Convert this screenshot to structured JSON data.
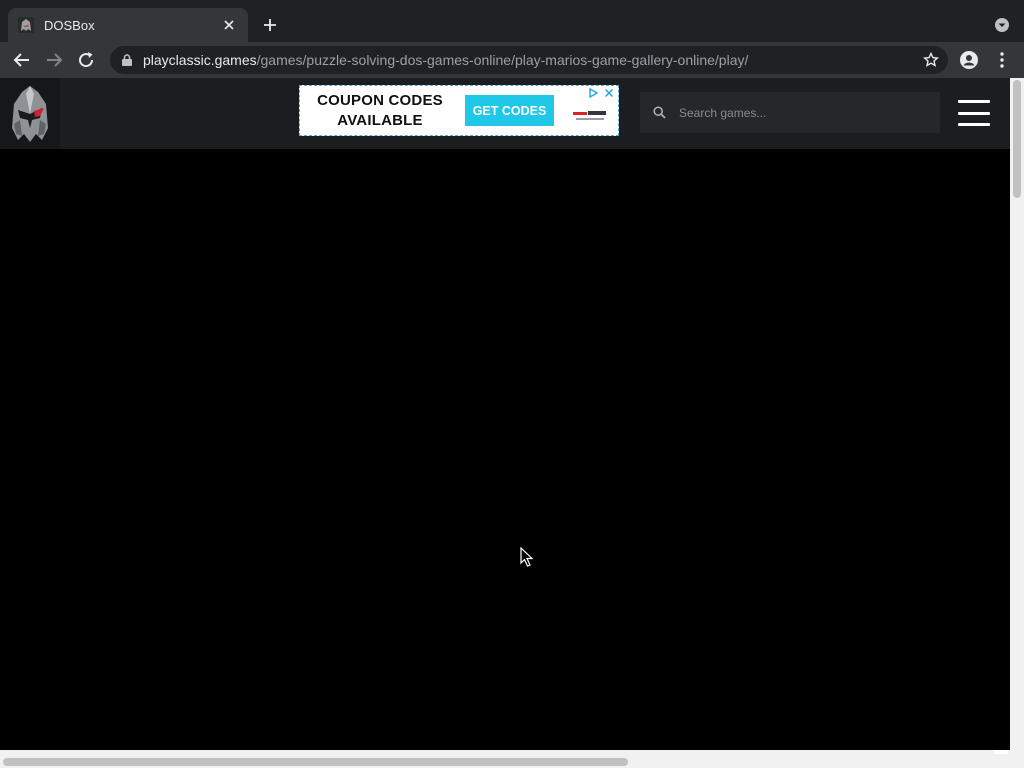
{
  "browser": {
    "tab": {
      "title": "DOSBox",
      "favicon": "helmet-favicon-icon"
    },
    "url": {
      "host": "playclassic.games",
      "path": "/games/puzzle-solving-dos-games-online/play-marios-game-gallery-online/play/"
    }
  },
  "site": {
    "logo": "knight-helmet-logo",
    "ad": {
      "headline_line1": "COUPON CODES",
      "headline_line2": "AVAILABLE",
      "cta": "GET CODES"
    },
    "search": {
      "placeholder": "Search games..."
    },
    "menu_icon": "hamburger-menu-icon"
  },
  "colors": {
    "browser_dark": "#202124",
    "browser_toolbar": "#35363a",
    "site_header": "#1c1d20",
    "ad_cta": "#1ec8e6",
    "game_background": "#000000"
  }
}
